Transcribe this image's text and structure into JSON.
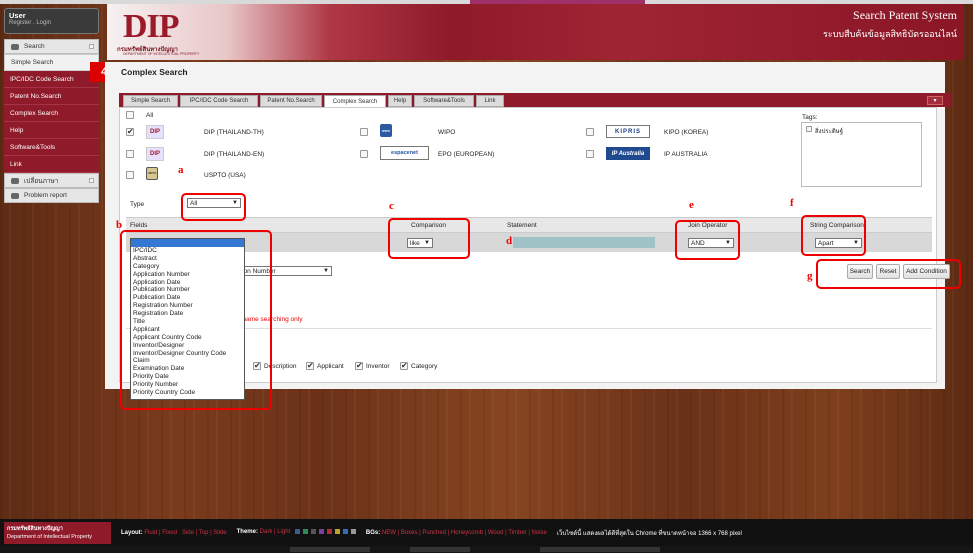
{
  "app": {
    "title": "Search Patent System",
    "subtitle_th": "ระบบสืบค้นข้อมูลสิทธิบัตรออนไลน์",
    "logo": "DIP",
    "logo_th": "กรมทรัพย์สินทางปัญญา",
    "logo_en": "DEPARTMENT OF INTELLECTUAL PROPERTY"
  },
  "user": {
    "name": "User",
    "links": "Register . Login"
  },
  "sidebar": {
    "search_header": "Search",
    "items": [
      "Simple Search",
      "IPC/IDC Code Search",
      "Patent No.Search",
      "Complex Search",
      "Help",
      "Software&Tools",
      "Link"
    ],
    "lang_header": "เปลี่ยนภาษา",
    "problem": "Problem report"
  },
  "annotation_badge": "4",
  "page_title": "Complex Search",
  "tabs": [
    "Simple Search",
    "IPC/IDC Code Search",
    "Patent No.Search",
    "Complex Search",
    "Help",
    "Software&Tools",
    "Link"
  ],
  "tab_menu": "▾",
  "sources": {
    "all": "All",
    "items": [
      {
        "label": "DIP (THAILAND-TH)",
        "logo": "DIP",
        "checked": true
      },
      {
        "label": "WIPO",
        "logo": "WIPO",
        "checked": false
      },
      {
        "label": "KIPO (KOREA)",
        "logo": "KIPRIS",
        "checked": false
      },
      {
        "label": "DIP (THAILAND-EN)",
        "logo": "DIP",
        "checked": false
      },
      {
        "label": "EPO (EUROPEAN)",
        "logo": "espacenet",
        "checked": false
      },
      {
        "label": "IP AUSTRALIA",
        "logo": "IP Australia",
        "checked": false
      },
      {
        "label": "USPTO (USA)",
        "logo": "USPTO",
        "checked": false
      }
    ]
  },
  "tags": {
    "title": "Tags:",
    "item": "สิ่งประดิษฐ์"
  },
  "type": {
    "label": "Type",
    "value": "All"
  },
  "grid": {
    "fields": "Fields",
    "comparison": "Comparison",
    "statement": "Statement",
    "join": "Join Operator",
    "string_comparison": "String Comparison"
  },
  "row": {
    "comparison": "like",
    "join": "AND",
    "string_comparison": "Apart"
  },
  "buttons": {
    "search": "Search",
    "reset": "Reset",
    "add": "Add Condition"
  },
  "second_select": "ication Number",
  "warning": "ion name searching only",
  "field_options": [
    "",
    "IPC/IDC",
    "Abstract",
    "Category",
    "Application Number",
    "Application Date",
    "Publication Number",
    "Publication Date",
    "Registration Number",
    "Registration Date",
    "Title",
    "Applicant",
    "Applicant Country Code",
    "Inventor/Designer",
    "Inventor/Designer Country Code",
    "Claim",
    "Examination Date",
    "Priority Date",
    "Priority Number",
    "Priority Country Code"
  ],
  "display_fields": [
    {
      "label": "Description",
      "checked": true
    },
    {
      "label": "Applicant",
      "checked": true
    },
    {
      "label": "Inventor",
      "checked": true
    },
    {
      "label": "Category",
      "checked": true
    }
  ],
  "markers": {
    "a": "a",
    "b": "b",
    "c": "c",
    "d": "d",
    "e": "e",
    "f": "f",
    "g": "g"
  },
  "footer": {
    "logo_th": "กรมทรัพย์สินทางปัญญา",
    "logo_en": "Department of Intellectual Property",
    "layout_label": "Layout:",
    "layout_opts": "Fluid | Fixed",
    "layout_side": "Side | Top | Slide",
    "theme_label": "Theme:",
    "theme_opts": "Dark | Light",
    "bgs_label": "BGs:",
    "bgs_opts": "NEW | Boxes | Punched | Honeycomb | Wood | Timber | Noise",
    "note": "เว็บไซต์นี้ แสดงผลได้ดีที่สุดใน Chrome ที่ขนาดหน้าจอ 1366 x 768 pixel",
    "swatches": [
      "#3b5b8c",
      "#2e8b57",
      "#555555",
      "#7a3fa0",
      "#b03030",
      "#c0a030",
      "#2f6fb0",
      "#999999"
    ]
  }
}
